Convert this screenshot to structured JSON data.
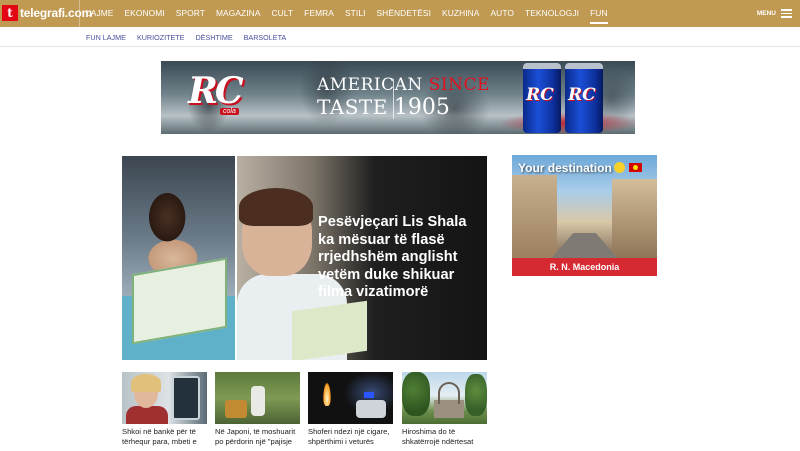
{
  "header": {
    "logo_mark": "t",
    "logo_text": "telegrafi.com",
    "nav": [
      "LAJME",
      "EKONOMI",
      "SPORT",
      "MAGAZINA",
      "CULT",
      "FEMRA",
      "STILI",
      "SHËNDETËSI",
      "KUZHINA",
      "AUTO",
      "TEKNOLOGJI",
      "FUN"
    ],
    "active_nav": "FUN",
    "menu_label": "MENU"
  },
  "subnav": [
    "FUN LAJME",
    "KURIOZITETE",
    "DËSHTIME",
    "BARSOLETA"
  ],
  "banner_ad": {
    "brand": "RC",
    "brand_sub": "cola",
    "line1_left": "AMERICAN",
    "line1_right": "SINCE",
    "line2_left": "TASTE",
    "line2_right": "1905",
    "can_label": "RC"
  },
  "main_article": {
    "title": "Pesëvjeçari Lis Shala ka mësuar të flasë rrjedhshëm anglisht vetëm duke shikuar filma vizatimorë"
  },
  "side_ad": {
    "headline": "Your destination",
    "footer": "R. N. Macedonia"
  },
  "articles": [
    {
      "caption": "Shkoi në bankë për të tërhequr para, mbeti e"
    },
    {
      "caption": "Në Japoni, të moshuarit po përdorin një \"pajisje"
    },
    {
      "caption": "Shoferi ndezi një cigare, shpërthimi i veturës"
    },
    {
      "caption": "Hiroshima do të shkatërrojë ndërtesat"
    }
  ],
  "colors": {
    "topbar": "#c09a52",
    "subnav_text": "#4a4f9e",
    "brand_red": "#e30613"
  }
}
